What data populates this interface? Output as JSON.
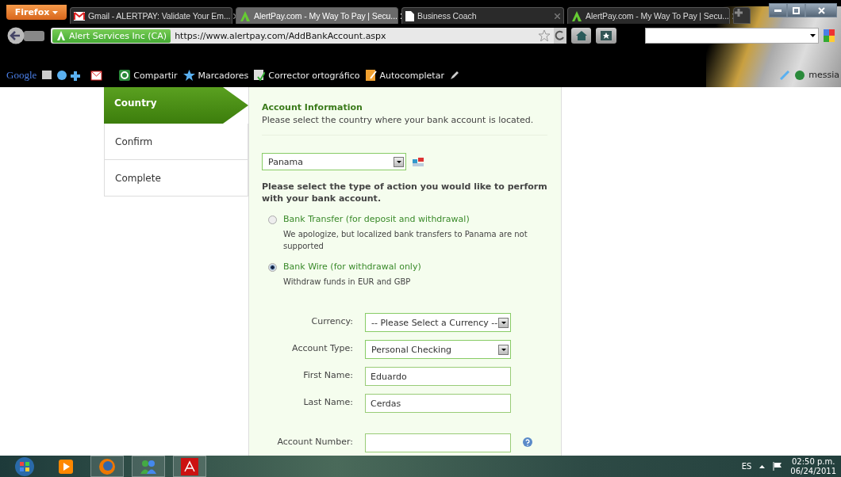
{
  "browser": {
    "menu_button": "Firefox",
    "tabs": [
      {
        "title": "Gmail - ALERTPAY: Validate Your Em...",
        "selected": false
      },
      {
        "title": "AlertPay.com - My Way To Pay | Secu...",
        "selected": true
      },
      {
        "title": "Business Coach",
        "selected": false
      },
      {
        "title": "AlertPay.com - My Way To Pay | Secu...",
        "selected": false
      }
    ],
    "site_identity": "Alert Services Inc (CA)",
    "url": "https://www.alertpay.com/AddBankAccount.aspx",
    "google_logo": "Google",
    "toolbar_items": [
      {
        "label": "Compartir"
      },
      {
        "label": "Marcadores"
      },
      {
        "label": "Corrector ortográfico"
      },
      {
        "label": "Autocompletar"
      }
    ],
    "profile": "messia"
  },
  "steps": [
    {
      "label": "Country",
      "selected": true
    },
    {
      "label": "Confirm",
      "selected": false
    },
    {
      "label": "Complete",
      "selected": false
    }
  ],
  "form": {
    "heading": "Account Information",
    "subtitle": "Please select the country where your bank account is located.",
    "country": "Panama",
    "prompt": "Please select the type of action you would like to perform with your bank account.",
    "options": [
      {
        "label": "Bank Transfer (for deposit and withdrawal)",
        "description": "We apologize, but localized bank transfers to Panama are not supported",
        "selected": false
      },
      {
        "label": "Bank Wire (for withdrawal only)",
        "description": "Withdraw funds in EUR and GBP",
        "selected": true
      }
    ],
    "fields": [
      {
        "label": "Currency:",
        "kind": "select",
        "value": "-- Please Select a Currency --"
      },
      {
        "label": "Account Type:",
        "kind": "select",
        "value": "Personal Checking"
      },
      {
        "label": "First Name:",
        "kind": "text",
        "value": "Eduardo"
      },
      {
        "label": "Last Name:",
        "kind": "text",
        "value": "Cerdas"
      },
      {
        "label": "Account Number:",
        "kind": "help"
      }
    ]
  },
  "taskbar": {
    "language": "ES",
    "time": "02:50 p.m.",
    "date": "06/24/2011"
  }
}
